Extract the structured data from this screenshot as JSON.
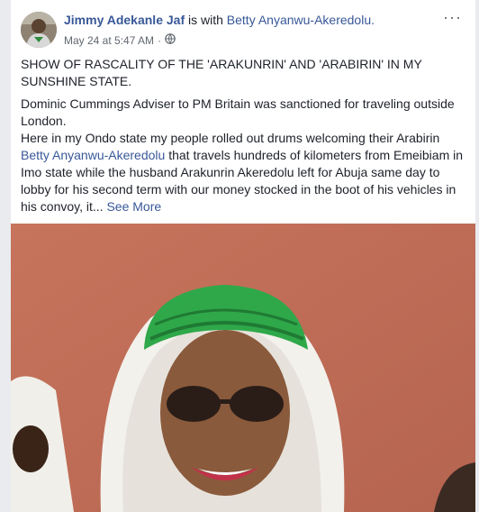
{
  "post": {
    "author": "Jimmy Adekanle Jaf",
    "with_text": "is with",
    "tagged_user": "Betty Anyanwu-Akeredolu.",
    "timestamp": "May 24 at 5:47 AM",
    "separator": "·",
    "privacy_icon": "globe-icon",
    "more_icon": "more-options-icon",
    "more_label": "···",
    "headline": "SHOW OF RASCALITY OF THE 'ARAKUNRIN' AND 'ARABIRIN' IN MY SUNSHINE STATE.",
    "paragraph_1": "Dominic Cummings Adviser to PM Britain was sanctioned for traveling outside London.",
    "paragraph_2_start": "Here in my Ondo state my people rolled out drums welcoming their Arabirin",
    "paragraph_2_mention": "Betty Anyanwu-Akeredolu",
    "paragraph_2_end": "that travels hundreds of kilometers from Emeibiam in Imo state while the husband Arakunrin Akeredolu left for Abuja same day to lobby for his second term with our money stocked in the boot of his vehicles in his convoy, it...",
    "see_more": "See More"
  },
  "colors": {
    "link": "#385898",
    "text": "#1d2129",
    "meta": "#616770",
    "background": "#e9ebee"
  }
}
